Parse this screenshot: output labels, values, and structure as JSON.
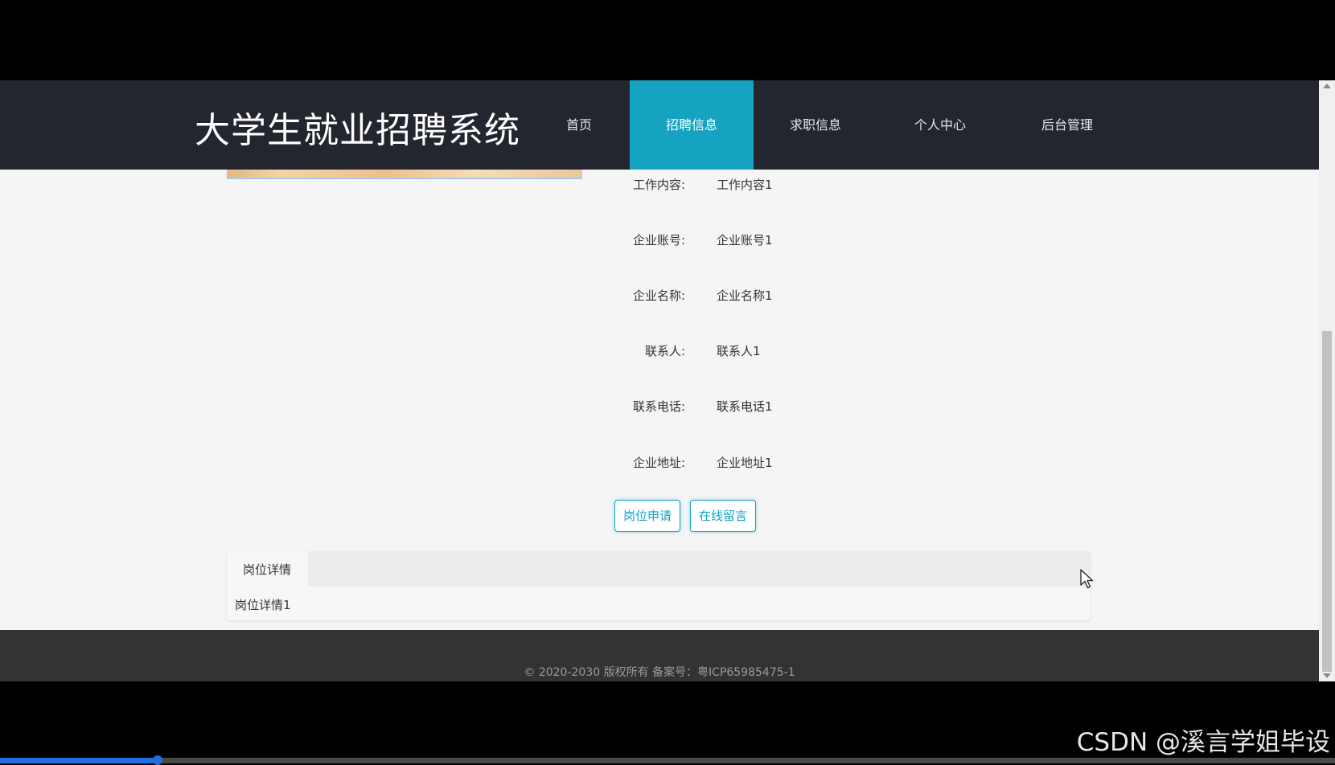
{
  "header": {
    "site_title": "大学生就业招聘系统",
    "nav": [
      {
        "label": "首页",
        "active": false
      },
      {
        "label": "招聘信息",
        "active": true
      },
      {
        "label": "求职信息",
        "active": false
      },
      {
        "label": "个人中心",
        "active": false
      },
      {
        "label": "后台管理",
        "active": false
      }
    ],
    "accent_color": "#16a3c2",
    "bar_color": "#23262e"
  },
  "fields": [
    {
      "label": "工作内容:",
      "value": "工作内容1"
    },
    {
      "label": "企业账号:",
      "value": "企业账号1"
    },
    {
      "label": "企业名称:",
      "value": "企业名称1"
    },
    {
      "label": "联系人:",
      "value": "联系人1"
    },
    {
      "label": "联系电话:",
      "value": "联系电话1"
    },
    {
      "label": "企业地址:",
      "value": "企业地址1"
    }
  ],
  "actions": {
    "apply_label": "岗位申请",
    "message_label": "在线留言"
  },
  "detail": {
    "tab_label": "岗位详情",
    "content": "岗位详情1"
  },
  "footer": {
    "copyright": "© 2020-2030 版权所有 备案号：粤ICP65985475-1"
  },
  "video": {
    "progress": 0.118
  },
  "watermark": "CSDN @溪言学姐毕设"
}
